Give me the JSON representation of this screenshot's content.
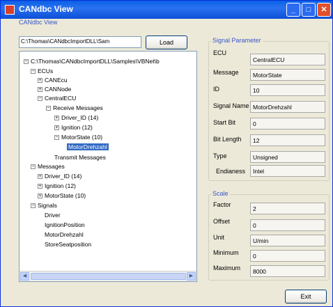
{
  "window": {
    "title": "CANdbc View",
    "min": "_",
    "max": "□",
    "close": "✕"
  },
  "group_caption": "CANdbc View",
  "path_input": {
    "value": "C:\\Thomas\\CANdbcImportDLL\\Sam"
  },
  "load_button": "Load",
  "exit_button": "Exit",
  "tree": [
    {
      "label": "C:\\Thomas\\CANdbcImportDLL\\Samples\\VBNet\\b",
      "expander": "−"
    },
    {
      "label": "ECUs",
      "expander": "−"
    },
    {
      "label": "CANEcu",
      "expander": "+"
    },
    {
      "label": "CANNode",
      "expander": "+"
    },
    {
      "label": "CentralECU",
      "expander": "−"
    },
    {
      "label": "Receive Messages",
      "expander": "−"
    },
    {
      "label": "Driver_ID (14)",
      "expander": "+"
    },
    {
      "label": "Ignition (12)",
      "expander": "+"
    },
    {
      "label": "MotorState (10)",
      "expander": "−"
    },
    {
      "label": "MotorDrehzahl",
      "expander": ""
    },
    {
      "label": "Transmit Messages",
      "expander": ""
    },
    {
      "label": "Messages",
      "expander": "−"
    },
    {
      "label": "Driver_ID (14)",
      "expander": "+"
    },
    {
      "label": "Ignition (12)",
      "expander": "+"
    },
    {
      "label": "MotorState (10)",
      "expander": "+"
    },
    {
      "label": "Signals",
      "expander": "−"
    },
    {
      "label": "Driver",
      "expander": ""
    },
    {
      "label": "IgnitionPosition",
      "expander": ""
    },
    {
      "label": "MotorDrehzahl",
      "expander": ""
    },
    {
      "label": "StoreSeatposition",
      "expander": ""
    }
  ],
  "scroll": {
    "left": "◀",
    "right": "▶"
  },
  "signal_params": {
    "title": "Signal Parameter",
    "fields": [
      {
        "label": "ECU",
        "value": "CentralECU"
      },
      {
        "label": "Message",
        "value": "MotorState"
      },
      {
        "label": "ID",
        "value": "10"
      },
      {
        "label": "Signal Name",
        "value": "MotorDrehzahl"
      },
      {
        "label": "Start Bit",
        "value": "0"
      },
      {
        "label": "Bit Length",
        "value": "12"
      },
      {
        "label": "Type",
        "value": "Unsigned"
      },
      {
        "label": "Endianess",
        "value": "Intel"
      }
    ]
  },
  "scale": {
    "title": "Scale",
    "fields": [
      {
        "label": "Factor",
        "value": "2"
      },
      {
        "label": "Offset",
        "value": "0"
      },
      {
        "label": "Unit",
        "value": "U/min"
      },
      {
        "label": "Minimum",
        "value": "0"
      },
      {
        "label": "Maximum",
        "value": "8000"
      }
    ]
  }
}
